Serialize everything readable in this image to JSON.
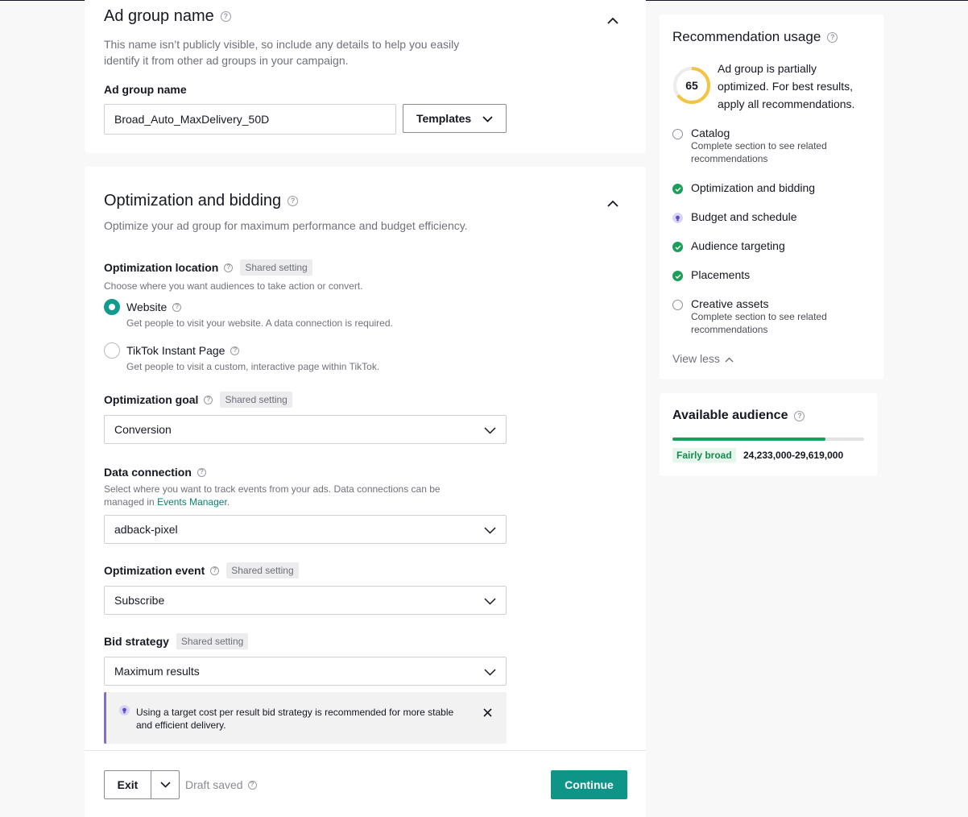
{
  "ad_group_section": {
    "title": "Ad group name",
    "description": "This name isn’t publicly visible, so include any details to help you easily identify it from other ad groups in your campaign.",
    "field_label": "Ad group name",
    "field_value": "Broad_Auto_MaxDelivery_50D",
    "templates_label": "Templates"
  },
  "optimization_section": {
    "title": "Optimization and bidding",
    "description": "Optimize your ad group for maximum performance and budget efficiency.",
    "shared_setting": "Shared setting",
    "location": {
      "label": "Optimization location",
      "description": "Choose where you want audiences to take action or convert.",
      "options": [
        {
          "label": "Website",
          "desc": "Get people to visit your website. A data connection is required.",
          "selected": true
        },
        {
          "label": "TikTok Instant Page",
          "desc": "Get people to visit a custom, interactive page within TikTok.",
          "selected": false
        }
      ]
    },
    "goal": {
      "label": "Optimization goal",
      "value": "Conversion"
    },
    "data_connection": {
      "label": "Data connection",
      "description": "Select where you want to track events from your ads. Data connections can be managed in",
      "link": "Events Manager",
      "period": ".",
      "value": "adback-pixel"
    },
    "event": {
      "label": "Optimization event",
      "value": "Subscribe"
    },
    "bid": {
      "label": "Bid strategy",
      "value": "Maximum results"
    },
    "tip": "Using a target cost per result bid strategy is recommended for more stable and efficient delivery."
  },
  "footer": {
    "exit_label": "Exit",
    "draft_status": "Draft saved",
    "continue_label": "Continue"
  },
  "recommendation": {
    "title": "Recommendation usage",
    "score": "65",
    "score_fraction": 0.65,
    "summary": "Ad group is partially optimized. For best results, apply all recommendations.",
    "items": [
      {
        "label": "Catalog",
        "status": "incomplete",
        "sub": "Complete section to see related recommendations"
      },
      {
        "label": "Optimization and bidding",
        "status": "done"
      },
      {
        "label": "Budget and schedule",
        "status": "suggestion"
      },
      {
        "label": "Audience targeting",
        "status": "done"
      },
      {
        "label": "Placements",
        "status": "done"
      },
      {
        "label": "Creative assets",
        "status": "incomplete",
        "sub": "Complete section to see related recommendations"
      }
    ],
    "view_less": "View less"
  },
  "audience": {
    "title": "Available audience",
    "badge": "Fairly broad",
    "range": "24,233,000-29,619,000",
    "fill_fraction": 0.8
  },
  "colors": {
    "accent": "#119b8f",
    "continue_bg": "#0f9488",
    "success": "#1a9e5a",
    "tip_border": "#7d6fd8",
    "score_ring": "#f5c342"
  }
}
